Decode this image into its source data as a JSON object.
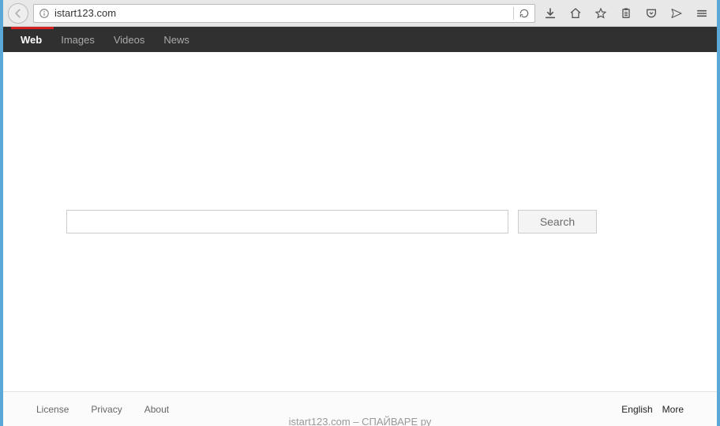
{
  "browser": {
    "url": "istart123.com"
  },
  "tabs": [
    {
      "label": "Web",
      "active": true
    },
    {
      "label": "Images",
      "active": false
    },
    {
      "label": "Videos",
      "active": false
    },
    {
      "label": "News",
      "active": false
    }
  ],
  "search": {
    "input_value": "",
    "button_label": "Search"
  },
  "footer": {
    "links": [
      "License",
      "Privacy",
      "About"
    ],
    "lang": "English",
    "more": "More"
  },
  "caption": "istart123.com – СПАЙВАРЕ ру"
}
